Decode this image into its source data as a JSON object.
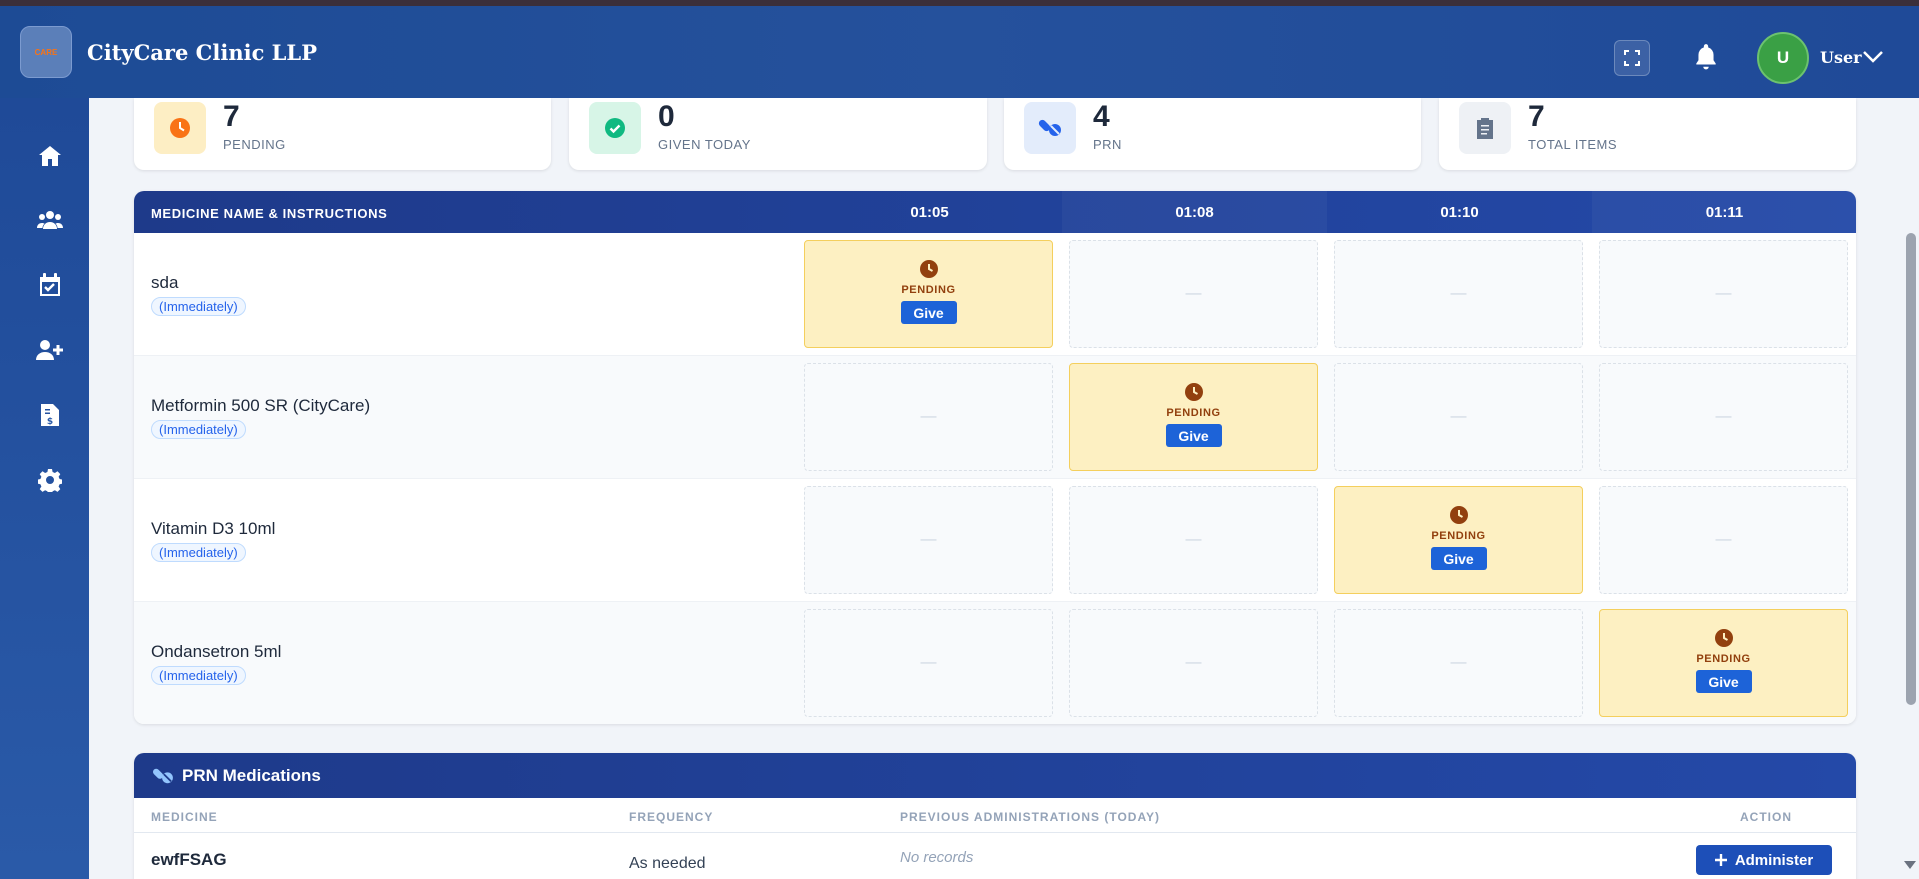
{
  "header": {
    "logo_text": "CARE",
    "clinic_name": "CityCare Clinic LLP",
    "user_initial": "U",
    "user_label": "User"
  },
  "sidebar": {
    "items": [
      {
        "icon": "home-icon"
      },
      {
        "icon": "users-icon"
      },
      {
        "icon": "calendar-check-icon"
      },
      {
        "icon": "user-plus-icon"
      },
      {
        "icon": "invoice-icon"
      },
      {
        "icon": "gear-icon"
      }
    ]
  },
  "stats": [
    {
      "value": "7",
      "label": "PENDING",
      "icon": "clock-icon",
      "color": "#f97316"
    },
    {
      "value": "0",
      "label": "GIVEN TODAY",
      "icon": "check-circle-icon",
      "color": "#10b981"
    },
    {
      "value": "4",
      "label": "PRN",
      "icon": "pills-icon",
      "color": "#2563eb"
    },
    {
      "value": "7",
      "label": "TOTAL ITEMS",
      "icon": "clipboard-icon",
      "color": "#64748b"
    }
  ],
  "mar": {
    "header_label": "MEDICINE NAME & INSTRUCTIONS",
    "times": [
      "01:05",
      "01:08",
      "01:10",
      "01:11"
    ],
    "empty_mark": "—",
    "pending_label": "PENDING",
    "give_label": "Give",
    "rows": [
      {
        "name": "sda",
        "tag": "(Immediately)",
        "pending_slot": 0
      },
      {
        "name": "Metformin 500 SR (CityCare)",
        "tag": "(Immediately)",
        "pending_slot": 1
      },
      {
        "name": "Vitamin D3 10ml",
        "tag": "(Immediately)",
        "pending_slot": 2
      },
      {
        "name": "Ondansetron 5ml",
        "tag": "(Immediately)",
        "pending_slot": 3
      }
    ]
  },
  "prn": {
    "title": "PRN Medications",
    "columns": [
      "MEDICINE",
      "FREQUENCY",
      "PREVIOUS ADMINISTRATIONS (TODAY)",
      "ACTION"
    ],
    "rows": [
      {
        "medicine": "ewfFSAG",
        "frequency": "As needed",
        "previous": "No records",
        "action": "Administer"
      }
    ]
  }
}
